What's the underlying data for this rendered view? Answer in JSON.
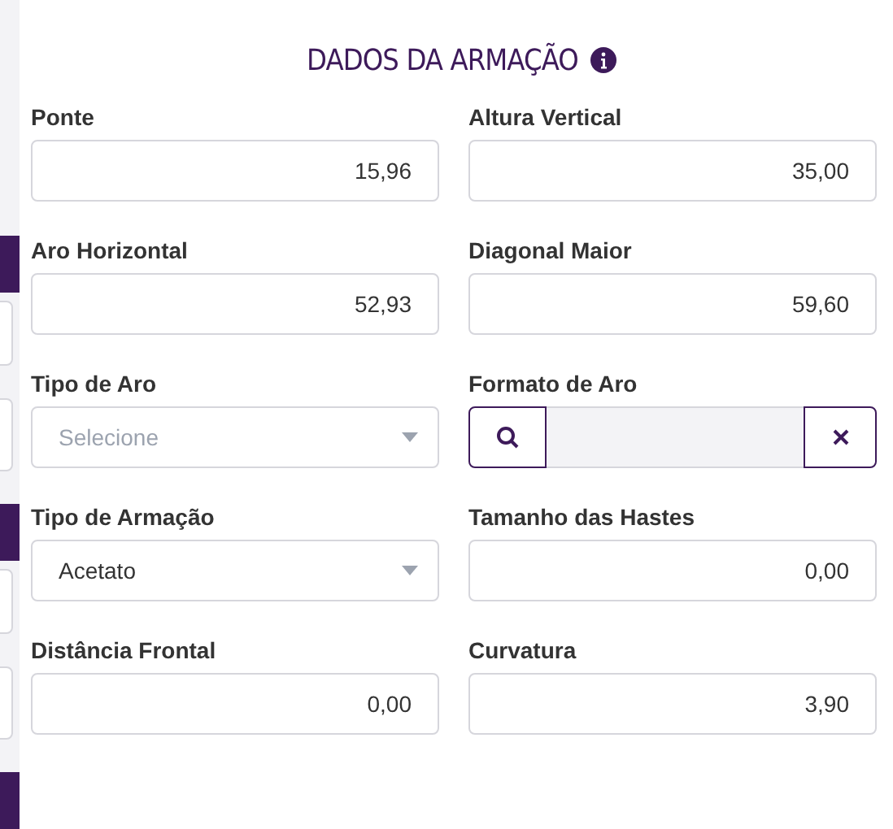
{
  "title": "DADOS DA ARMAÇÃO",
  "fields": [
    {
      "label": "Ponte",
      "kind": "number",
      "value": "15,96"
    },
    {
      "label": "Altura Vertical",
      "kind": "number",
      "value": "35,00"
    },
    {
      "label": "Aro Horizontal",
      "kind": "number",
      "value": "52,93"
    },
    {
      "label": "Diagonal Maior",
      "kind": "number",
      "value": "59,60"
    },
    {
      "label": "Tipo de Aro",
      "kind": "select",
      "placeholder": "Selecione"
    },
    {
      "label": "Formato de Aro",
      "kind": "lookup"
    },
    {
      "label": "Tipo de Armação",
      "kind": "select",
      "value": "Acetato"
    },
    {
      "label": "Tamanho das Hastes",
      "kind": "number",
      "value": "0,00"
    },
    {
      "label": "Distância Frontal",
      "kind": "number",
      "value": "0,00"
    },
    {
      "label": "Curvatura",
      "kind": "number",
      "value": "3,90"
    }
  ]
}
